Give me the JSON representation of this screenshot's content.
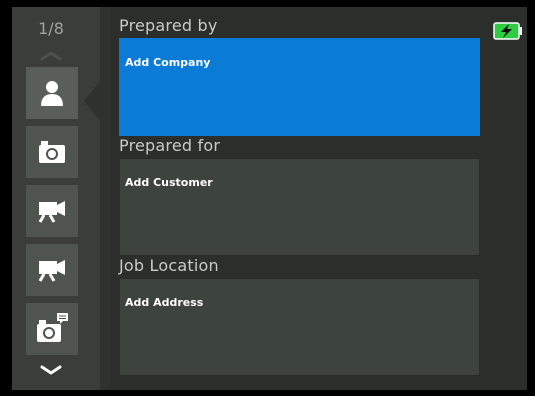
{
  "sidebar": {
    "page_counter": "1/8",
    "buttons": [
      {
        "name": "nav-profile-button",
        "icon": "person-icon",
        "active": true
      },
      {
        "name": "nav-photo-button",
        "icon": "camera-icon",
        "active": false
      },
      {
        "name": "nav-video-button",
        "icon": "video-camera-icon",
        "active": false
      },
      {
        "name": "nav-video-2-button",
        "icon": "video-camera-icon",
        "active": false
      },
      {
        "name": "nav-photo-note-button",
        "icon": "camera-note-icon",
        "active": false
      }
    ]
  },
  "form": {
    "prepared_by": {
      "label": "Prepared by",
      "value": "Add Company"
    },
    "prepared_for": {
      "label": "Prepared for",
      "value": "Add Customer"
    },
    "job_location": {
      "label": "Job Location",
      "value": "Add Address"
    }
  },
  "status": {
    "battery_icon": "battery-charging-icon",
    "battery_color": "#2ecc40"
  },
  "colors": {
    "selected_field": "#0a7bd6",
    "field": "#3d433d",
    "background": "#2c2e2c"
  }
}
